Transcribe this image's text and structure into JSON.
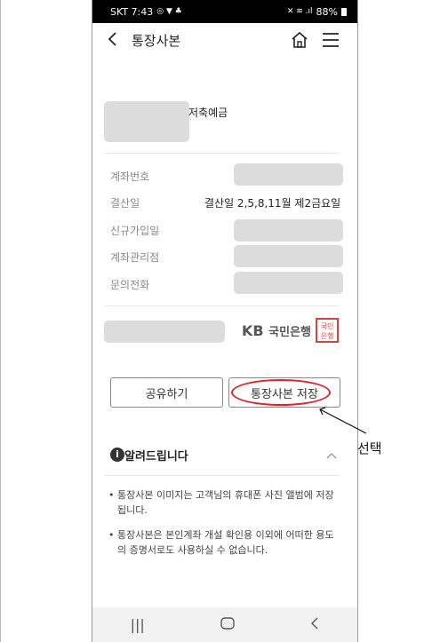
{
  "status": {
    "carrier_time": "SKT 7:43",
    "battery": "88%"
  },
  "appbar": {
    "title": "통장사본"
  },
  "account": {
    "product_name": "저축예금"
  },
  "fields": [
    {
      "label": "계좌번호",
      "value": ""
    },
    {
      "label": "결산일",
      "value": "결산일 2,5,8,11월 제2금요일"
    },
    {
      "label": "신규가입일",
      "value": ""
    },
    {
      "label": "계좌관리점",
      "value": ""
    },
    {
      "label": "문의전화",
      "value": ""
    }
  ],
  "bank": {
    "logo_kb": "KB",
    "logo_name": "국민은행",
    "seal_text": "국민은행"
  },
  "buttons": {
    "share": "공유하기",
    "save": "통장사본 저장"
  },
  "notice": {
    "title": "알려드립니다",
    "items": [
      "통장사본 이미지는 고객님의 휴대폰 사진 앨범에 저장됩니다.",
      "통장사본은 본인계좌 개설 확인용 이외에 어떠한 용도의 증명서로도 사용하실 수 없습니다."
    ]
  },
  "annotation": {
    "label": "선택"
  },
  "colors": {
    "seal": "#d7443e",
    "highlight_ellipse": "#e0232a"
  }
}
